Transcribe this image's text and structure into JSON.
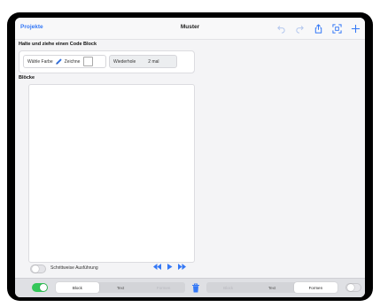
{
  "navbar": {
    "back_label": "Projekte",
    "title": "Muster",
    "accent_color": "#3478f6",
    "icons": [
      "undo-icon",
      "redo-icon",
      "share-icon",
      "qr-scan-icon",
      "add-icon"
    ]
  },
  "palette": {
    "heading": "Halte und ziehe einen Code Block",
    "choose_color_label": "Wähle Farbe",
    "draw_label": "Zeichne",
    "repeat_label": "Wiederhole",
    "repeat_value": "2 mal"
  },
  "workspace": {
    "heading": "Blöcke"
  },
  "controls": {
    "step_label": "Schrittweise Ausführung",
    "step_toggle_on": false
  },
  "bottombar": {
    "left_toggle_on": true,
    "left_segments": [
      {
        "label": "Block",
        "selected": true,
        "enabled": true
      },
      {
        "label": "Text",
        "selected": false,
        "enabled": true
      },
      {
        "label": "Formen",
        "selected": false,
        "enabled": false
      }
    ],
    "right_segments": [
      {
        "label": "Block",
        "selected": false,
        "enabled": false
      },
      {
        "label": "Text",
        "selected": false,
        "enabled": true
      },
      {
        "label": "Formen",
        "selected": true,
        "enabled": true
      }
    ],
    "right_toggle_on": false
  }
}
